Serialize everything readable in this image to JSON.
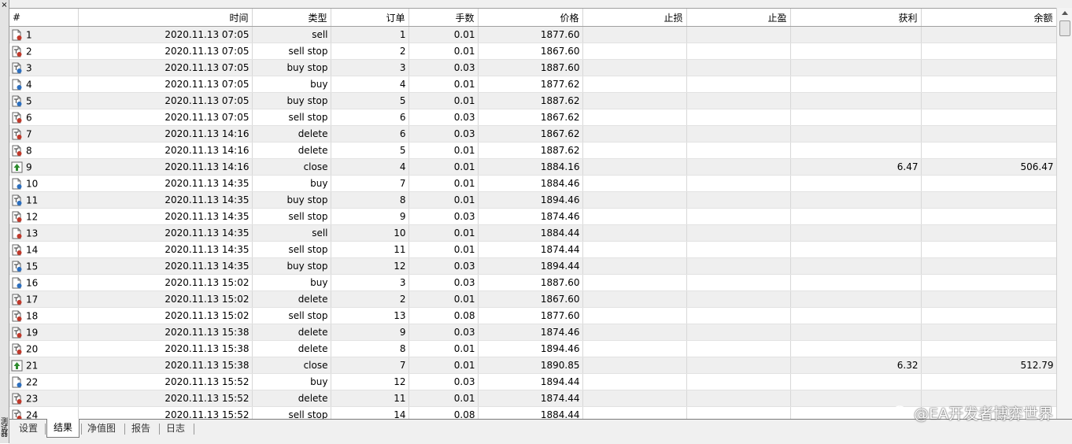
{
  "window": {
    "close_glyph": "×",
    "side_label": "测试器"
  },
  "columns": [
    "#",
    "时间",
    "类型",
    "订单",
    "手数",
    "价格",
    "止损",
    "止盈",
    "获利",
    "余额"
  ],
  "rows": [
    {
      "num": "1",
      "time": "2020.11.13 07:05",
      "type": "sell",
      "order": "1",
      "lots": "0.01",
      "price": "1877.60",
      "sl": "",
      "tp": "",
      "profit": "",
      "balance": "",
      "icon": "sell-order-icon"
    },
    {
      "num": "2",
      "time": "2020.11.13 07:05",
      "type": "sell stop",
      "order": "2",
      "lots": "0.01",
      "price": "1867.60",
      "sl": "",
      "tp": "",
      "profit": "",
      "balance": "",
      "icon": "pending-sell-order-icon"
    },
    {
      "num": "3",
      "time": "2020.11.13 07:05",
      "type": "buy stop",
      "order": "3",
      "lots": "0.03",
      "price": "1887.60",
      "sl": "",
      "tp": "",
      "profit": "",
      "balance": "",
      "icon": "pending-buy-order-icon"
    },
    {
      "num": "4",
      "time": "2020.11.13 07:05",
      "type": "buy",
      "order": "4",
      "lots": "0.01",
      "price": "1877.62",
      "sl": "",
      "tp": "",
      "profit": "",
      "balance": "",
      "icon": "buy-order-icon"
    },
    {
      "num": "5",
      "time": "2020.11.13 07:05",
      "type": "buy stop",
      "order": "5",
      "lots": "0.01",
      "price": "1887.62",
      "sl": "",
      "tp": "",
      "profit": "",
      "balance": "",
      "icon": "pending-buy-order-icon"
    },
    {
      "num": "6",
      "time": "2020.11.13 07:05",
      "type": "sell stop",
      "order": "6",
      "lots": "0.03",
      "price": "1867.62",
      "sl": "",
      "tp": "",
      "profit": "",
      "balance": "",
      "icon": "pending-sell-order-icon"
    },
    {
      "num": "7",
      "time": "2020.11.13 14:16",
      "type": "delete",
      "order": "6",
      "lots": "0.03",
      "price": "1867.62",
      "sl": "",
      "tp": "",
      "profit": "",
      "balance": "",
      "icon": "delete-order-icon"
    },
    {
      "num": "8",
      "time": "2020.11.13 14:16",
      "type": "delete",
      "order": "5",
      "lots": "0.01",
      "price": "1887.62",
      "sl": "",
      "tp": "",
      "profit": "",
      "balance": "",
      "icon": "delete-order-icon"
    },
    {
      "num": "9",
      "time": "2020.11.13 14:16",
      "type": "close",
      "order": "4",
      "lots": "0.01",
      "price": "1884.16",
      "sl": "",
      "tp": "",
      "profit": "6.47",
      "balance": "506.47",
      "icon": "close-order-icon"
    },
    {
      "num": "10",
      "time": "2020.11.13 14:35",
      "type": "buy",
      "order": "7",
      "lots": "0.01",
      "price": "1884.46",
      "sl": "",
      "tp": "",
      "profit": "",
      "balance": "",
      "icon": "buy-order-icon"
    },
    {
      "num": "11",
      "time": "2020.11.13 14:35",
      "type": "buy stop",
      "order": "8",
      "lots": "0.01",
      "price": "1894.46",
      "sl": "",
      "tp": "",
      "profit": "",
      "balance": "",
      "icon": "pending-buy-order-icon"
    },
    {
      "num": "12",
      "time": "2020.11.13 14:35",
      "type": "sell stop",
      "order": "9",
      "lots": "0.03",
      "price": "1874.46",
      "sl": "",
      "tp": "",
      "profit": "",
      "balance": "",
      "icon": "pending-sell-order-icon"
    },
    {
      "num": "13",
      "time": "2020.11.13 14:35",
      "type": "sell",
      "order": "10",
      "lots": "0.01",
      "price": "1884.44",
      "sl": "",
      "tp": "",
      "profit": "",
      "balance": "",
      "icon": "sell-order-icon"
    },
    {
      "num": "14",
      "time": "2020.11.13 14:35",
      "type": "sell stop",
      "order": "11",
      "lots": "0.01",
      "price": "1874.44",
      "sl": "",
      "tp": "",
      "profit": "",
      "balance": "",
      "icon": "pending-sell-order-icon"
    },
    {
      "num": "15",
      "time": "2020.11.13 14:35",
      "type": "buy stop",
      "order": "12",
      "lots": "0.03",
      "price": "1894.44",
      "sl": "",
      "tp": "",
      "profit": "",
      "balance": "",
      "icon": "pending-buy-order-icon"
    },
    {
      "num": "16",
      "time": "2020.11.13 15:02",
      "type": "buy",
      "order": "3",
      "lots": "0.03",
      "price": "1887.60",
      "sl": "",
      "tp": "",
      "profit": "",
      "balance": "",
      "icon": "buy-order-icon"
    },
    {
      "num": "17",
      "time": "2020.11.13 15:02",
      "type": "delete",
      "order": "2",
      "lots": "0.01",
      "price": "1867.60",
      "sl": "",
      "tp": "",
      "profit": "",
      "balance": "",
      "icon": "delete-order-icon"
    },
    {
      "num": "18",
      "time": "2020.11.13 15:02",
      "type": "sell stop",
      "order": "13",
      "lots": "0.08",
      "price": "1877.60",
      "sl": "",
      "tp": "",
      "profit": "",
      "balance": "",
      "icon": "pending-sell-order-icon"
    },
    {
      "num": "19",
      "time": "2020.11.13 15:38",
      "type": "delete",
      "order": "9",
      "lots": "0.03",
      "price": "1874.46",
      "sl": "",
      "tp": "",
      "profit": "",
      "balance": "",
      "icon": "delete-order-icon"
    },
    {
      "num": "20",
      "time": "2020.11.13 15:38",
      "type": "delete",
      "order": "8",
      "lots": "0.01",
      "price": "1894.46",
      "sl": "",
      "tp": "",
      "profit": "",
      "balance": "",
      "icon": "delete-order-icon"
    },
    {
      "num": "21",
      "time": "2020.11.13 15:38",
      "type": "close",
      "order": "7",
      "lots": "0.01",
      "price": "1890.85",
      "sl": "",
      "tp": "",
      "profit": "6.32",
      "balance": "512.79",
      "icon": "close-order-icon"
    },
    {
      "num": "22",
      "time": "2020.11.13 15:52",
      "type": "buy",
      "order": "12",
      "lots": "0.03",
      "price": "1894.44",
      "sl": "",
      "tp": "",
      "profit": "",
      "balance": "",
      "icon": "buy-order-icon"
    },
    {
      "num": "23",
      "time": "2020.11.13 15:52",
      "type": "delete",
      "order": "11",
      "lots": "0.01",
      "price": "1874.44",
      "sl": "",
      "tp": "",
      "profit": "",
      "balance": "",
      "icon": "delete-order-icon"
    },
    {
      "num": "24",
      "time": "2020.11.13 15:52",
      "type": "sell stop",
      "order": "14",
      "lots": "0.08",
      "price": "1884.44",
      "sl": "",
      "tp": "",
      "profit": "",
      "balance": "",
      "icon": "pending-sell-order-icon"
    }
  ],
  "tabs": [
    {
      "label": "设置",
      "active": false
    },
    {
      "label": "结果",
      "active": true
    },
    {
      "label": "净值图",
      "active": false
    },
    {
      "label": "报告",
      "active": false
    },
    {
      "label": "日志",
      "active": false
    }
  ],
  "watermark": "@EA开发者博弈世界",
  "colors": {
    "row_alt": "#efefef",
    "icon_red": "#c0392b",
    "icon_blue": "#2c6fbf",
    "icon_green": "#2e8b2e"
  }
}
